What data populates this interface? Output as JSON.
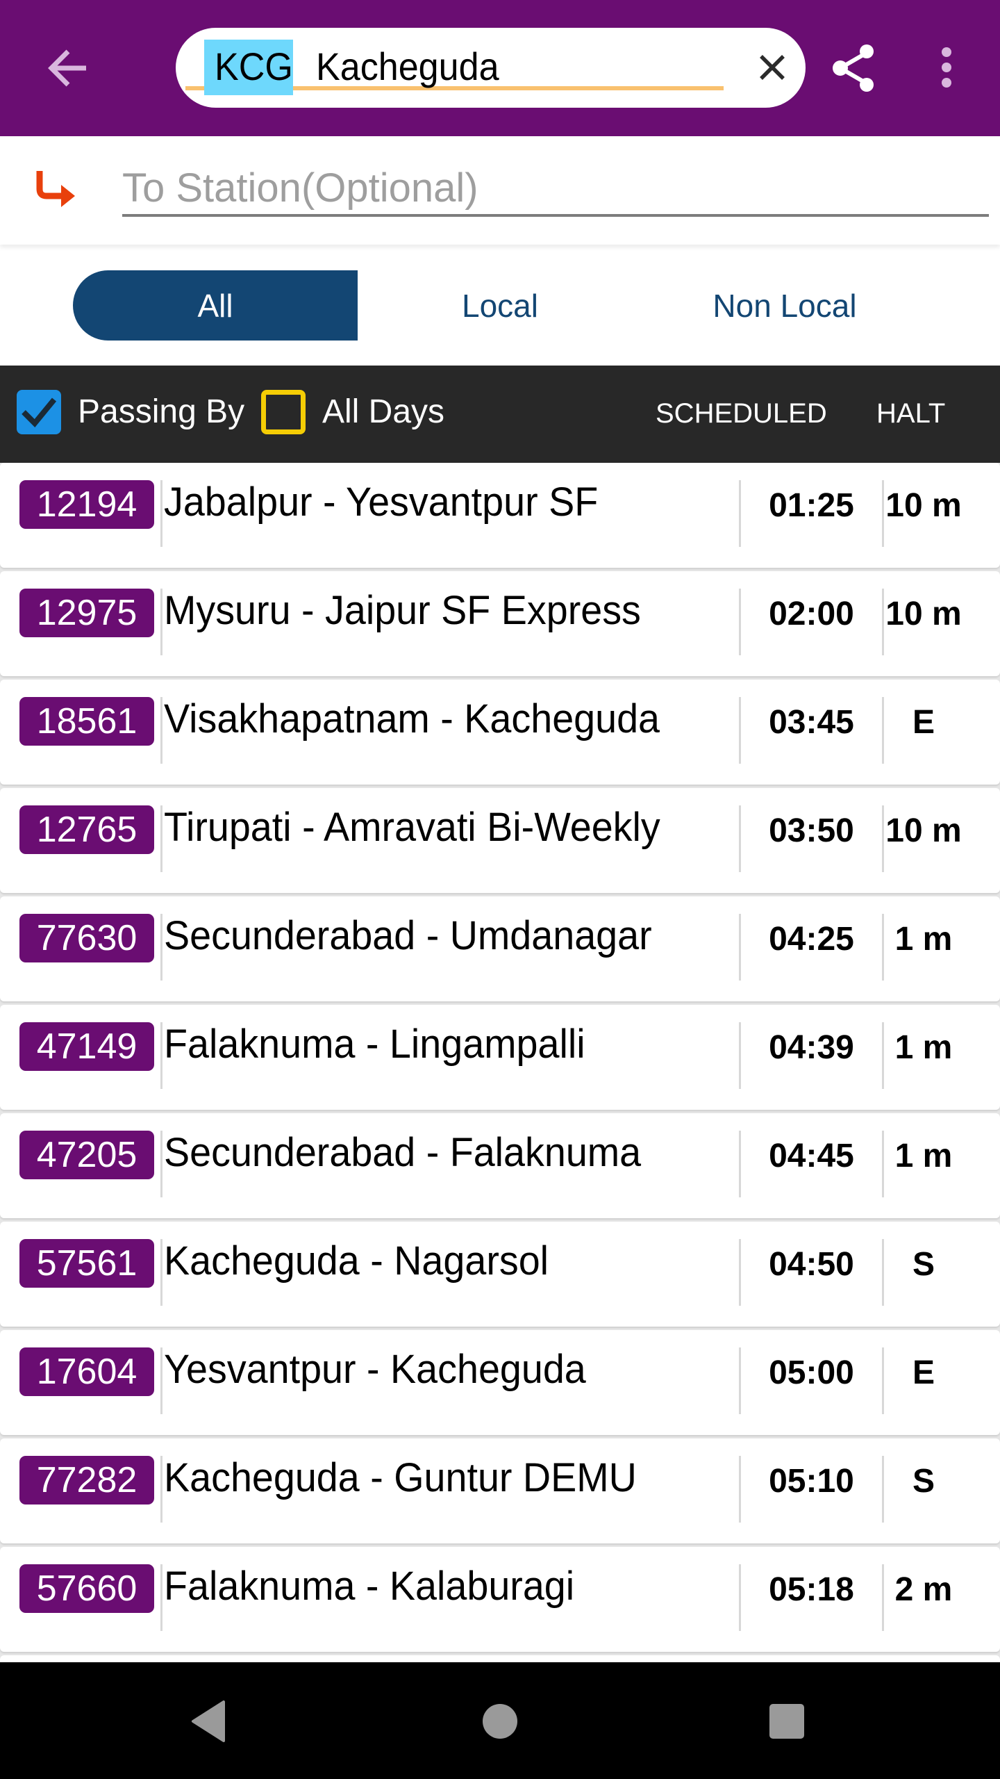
{
  "header": {
    "back_icon": "arrow-left-icon",
    "search": {
      "station_code": "KCG",
      "station_name": "Kacheguda",
      "clear_icon": "close-icon"
    },
    "share_icon": "share-icon",
    "more_icon": "more-vertical-icon"
  },
  "to_station": {
    "icon": "turn-right-arrow-icon",
    "placeholder": "To Station(Optional)",
    "value": ""
  },
  "tabs": [
    {
      "label": "All",
      "active": true
    },
    {
      "label": "Local",
      "active": false
    },
    {
      "label": "Non Local",
      "active": false
    }
  ],
  "filters": {
    "passing_by": {
      "label": "Passing By",
      "checked": true
    },
    "all_days": {
      "label": "All Days",
      "checked": false
    }
  },
  "columns": {
    "scheduled": "SCHEDULED",
    "halt": "HALT"
  },
  "trains": [
    {
      "number": "12194",
      "name": "Jabalpur - Yesvantpur SF",
      "scheduled": "01:25",
      "halt": "10 m"
    },
    {
      "number": "12975",
      "name": "Mysuru - Jaipur SF Express",
      "scheduled": "02:00",
      "halt": "10 m"
    },
    {
      "number": "18561",
      "name": "Visakhapatnam - Kacheguda",
      "scheduled": "03:45",
      "halt": "E"
    },
    {
      "number": "12765",
      "name": "Tirupati - Amravati Bi-Weekly",
      "scheduled": "03:50",
      "halt": "10 m"
    },
    {
      "number": "77630",
      "name": "Secunderabad - Umdanagar",
      "scheduled": "04:25",
      "halt": "1 m"
    },
    {
      "number": "47149",
      "name": "Falaknuma - Lingampalli",
      "scheduled": "04:39",
      "halt": "1 m"
    },
    {
      "number": "47205",
      "name": "Secunderabad - Falaknuma",
      "scheduled": "04:45",
      "halt": "1 m"
    },
    {
      "number": "57561",
      "name": "Kacheguda - Nagarsol",
      "scheduled": "04:50",
      "halt": "S"
    },
    {
      "number": "17604",
      "name": "Yesvantpur - Kacheguda",
      "scheduled": "05:00",
      "halt": "E"
    },
    {
      "number": "77282",
      "name": "Kacheguda - Guntur DEMU",
      "scheduled": "05:10",
      "halt": "S"
    },
    {
      "number": "57660",
      "name": "Falaknuma - Kalaburagi",
      "scheduled": "05:18",
      "halt": "2 m"
    }
  ],
  "colors": {
    "brand_purple": "#6a0d72",
    "tab_active": "#134673",
    "checkbox_checked": "#1c91e5",
    "checkbox_unchecked_border": "#f5cd05",
    "code_highlight": "#6ed8fc",
    "search_underline": "#f9c16f",
    "to_icon": "#e8400c"
  },
  "navbar": {
    "back_icon": "nav-back-icon",
    "home_icon": "nav-home-icon",
    "recents_icon": "nav-recents-icon"
  }
}
